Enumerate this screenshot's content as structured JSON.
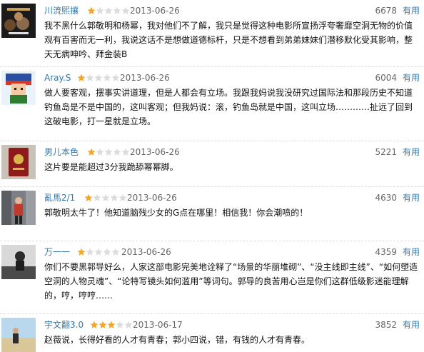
{
  "colors": {
    "link": "#3377aa",
    "star_on": "#f5a623",
    "star_off": "#dcdcdc",
    "text": "#111111",
    "muted": "#666666"
  },
  "useful_label": "有用",
  "reviews": [
    {
      "username": "川流熙攘",
      "rating": 1,
      "date": "2013-06-26",
      "votes": "6678",
      "avatar_icon": "film-poster-avatar",
      "content": "我不黑什么郭敬明和杨幂，我对他们不了解，我只是觉得这种电影所宣扬浮夸奢靡空洞无物的价值观有百害而无一利，我说这话不是想做道德标杆，只是不想看到弟弟妹妹们潜移默化受其影响，整天无病呻吟、拜金装B"
    },
    {
      "username": "Aray.S",
      "rating": 1,
      "date": "2013-06-26",
      "votes": "6004",
      "avatar_icon": "pixel-character-avatar",
      "content": "做人要客观，摆事实讲道理，但是人都会有立场。我跟我妈说我没研究过国际法和那段历史不知道钓鱼岛是不是中国的，这叫客观；但我妈说：滚，钓鱼岛就是中国，这叫立场…………扯远了回到这破电影，打一星就是立场。"
    },
    {
      "username": "男儿本色",
      "rating": 1,
      "date": "2013-06-26",
      "votes": "5221",
      "avatar_icon": "passport-avatar",
      "content": "这片要是能超过3分我跪舔幂幂脚。"
    },
    {
      "username": "亂馬2/1",
      "rating": 1,
      "date": "2013-06-26",
      "votes": "4630",
      "avatar_icon": "street-person-avatar",
      "content": "郭敬明太牛了！他知道脑残少女的G点在哪里！相信我！你会潮喷的！"
    },
    {
      "username": "万一一",
      "rating": 1,
      "date": "2013-06-26",
      "votes": "4359",
      "avatar_icon": "bw-photo-avatar",
      "content": "你们不要黑郭导好么，人家这部电影完美地诠释了“场景的华丽堆砌”、“没主线即主线”、“如何塑造空洞的人物灵魂”、“论特写镜头如何滥用”等词句。郭导的良苦用心岂是你们这群低级影迷能理解的，哼，哼哼……"
    },
    {
      "username": "宇文翻3.0",
      "rating": 3,
      "date": "2013-06-17",
      "votes": "3852",
      "avatar_icon": "beach-person-avatar",
      "content": "赵薇说，长得好看的人才有青春；郭小四说，错，有钱的人才有青春。"
    }
  ]
}
